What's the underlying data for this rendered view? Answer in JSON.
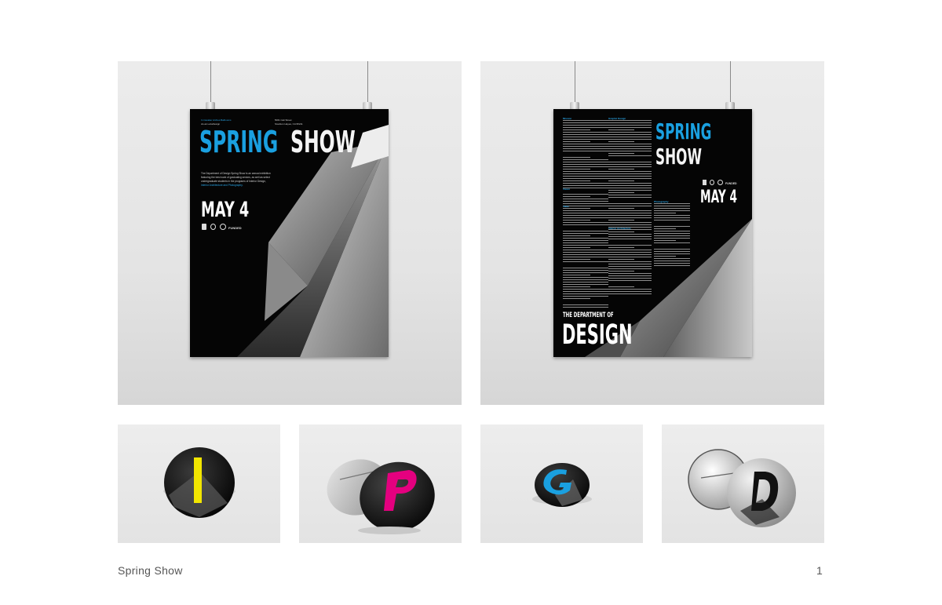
{
  "poster_left": {
    "header_left_1": "In Cavalier Arches Ballrooms",
    "header_left_2": "cis.arc.edu/design",
    "header_right_1": "5001 Cali Street",
    "header_right_2": "Stockton Hayes, CA 95211",
    "title_spring": "SPRING",
    "title_show": "SHOW",
    "blurb_1": "The Department of Design Spring Show is an annual exhibition",
    "blurb_2": "featuring the best work of graduating seniors, as well as select",
    "blurb_3": "undergraduate students in the programs of Interior Design,",
    "blurb_4": "Interior Architecture and Photography.",
    "date": "MAY 4",
    "sponsor_text": "FUNDED"
  },
  "poster_right": {
    "title_spring": "SPRING",
    "title_show": "SHOW",
    "date": "MAY 4",
    "dept_label": "THE DEPARTMENT OF",
    "dept_big": "DESIGN",
    "sponsor_text": "FUNDED",
    "col_heads": [
      "Mission",
      "Graphic Design",
      "Vision",
      "Interior Architecture",
      "Photography",
      "Value"
    ]
  },
  "buttons": [
    {
      "letter": "I",
      "letter_color": "#f2e600"
    },
    {
      "letter": "P",
      "letter_color": "#e4007f"
    },
    {
      "letter": "G",
      "letter_color": "#1aa0e0"
    },
    {
      "letter": "D",
      "letter_color": "#111111"
    }
  ],
  "colors": {
    "accent_blue": "#1aa0e0",
    "poster_bg": "#050505"
  },
  "footer": {
    "title": "Spring Show",
    "page": "1"
  }
}
